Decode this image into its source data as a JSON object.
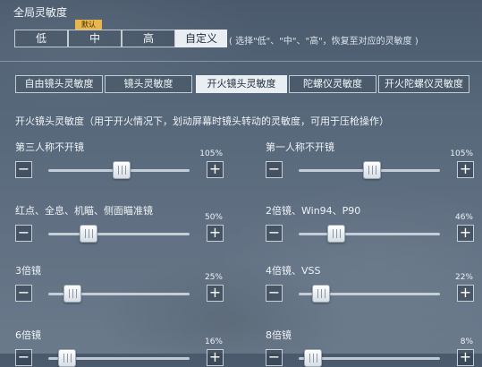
{
  "section_title": "全局灵敏度",
  "presets": {
    "default_badge": "默认",
    "options": [
      "低",
      "中",
      "高",
      "自定义"
    ],
    "selected": "自定义",
    "hint": "( 选择\"低\"、\"中\"、\"高\"，恢复至对应的灵敏度 )"
  },
  "tabs": {
    "items": [
      "自由镜头灵敏度",
      "镜头灵敏度",
      "开火镜头灵敏度",
      "陀螺仪灵敏度",
      "开火陀螺仪灵敏度"
    ],
    "selected": "开火镜头灵敏度"
  },
  "section_desc": "开火镜头灵敏度（用于开火情况下，划动屏幕时镜头转动的灵敏度，可用于压枪操作）",
  "buttons": {
    "minus": "−",
    "plus": "+"
  },
  "sliders": [
    {
      "label": "第三人称不开镜",
      "value": "105%"
    },
    {
      "label": "第一人称不开镜",
      "value": "105%"
    },
    {
      "label": "红点、全息、机瞄、侧面瞄准镜",
      "value": "50%"
    },
    {
      "label": "2倍镜、Win94、P90",
      "value": "46%"
    },
    {
      "label": "3倍镜",
      "value": "25%"
    },
    {
      "label": "4倍镜、VSS",
      "value": "22%"
    },
    {
      "label": "6倍镜",
      "value": "16%"
    },
    {
      "label": "8倍镜",
      "value": "8%"
    }
  ]
}
